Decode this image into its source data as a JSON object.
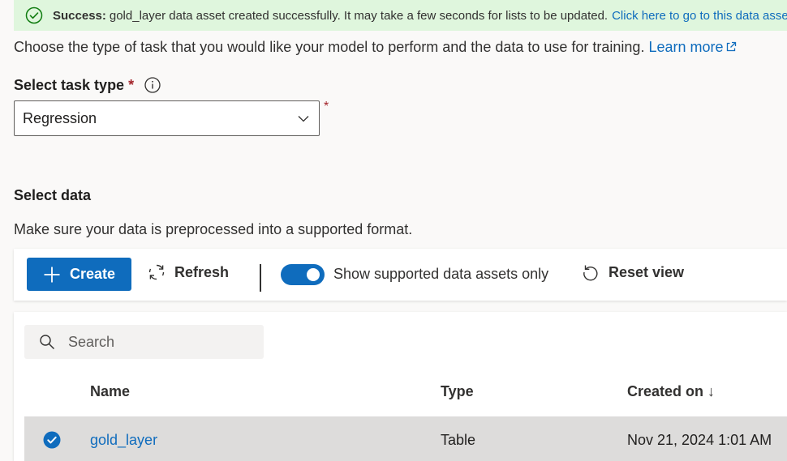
{
  "banner": {
    "lead": "Success:",
    "message": "gold_layer data asset created successfully. It may take a few seconds for lists to be updated.",
    "link": "Click here to go to this data asset"
  },
  "intro": {
    "text": "Choose the type of task that you would like your model to perform and the data to use for training.",
    "learn_more": "Learn more"
  },
  "task": {
    "label": "Select task type",
    "required_mark": "*",
    "selected": "Regression"
  },
  "data_section": {
    "title": "Select data",
    "description": "Make sure your data is preprocessed into a supported format."
  },
  "toolbar": {
    "create": "Create",
    "refresh": "Refresh",
    "toggle_label": "Show supported data assets only",
    "toggle_on": true,
    "reset": "Reset view"
  },
  "search": {
    "placeholder": "Search"
  },
  "table": {
    "columns": {
      "name": "Name",
      "type": "Type",
      "created": "Created on ↓"
    },
    "rows": [
      {
        "name": "gold_layer",
        "type": "Table",
        "created": "Nov 21, 2024 1:01 AM",
        "selected": true
      }
    ]
  },
  "colors": {
    "accent": "#0f6cbd",
    "success_bg": "#dff6dd",
    "success_icon": "#107c10",
    "required": "#a4262c"
  },
  "icons": [
    "success-check-icon",
    "external-link-icon",
    "info-icon",
    "chevron-down-icon",
    "plus-icon",
    "refresh-icon",
    "reset-icon",
    "search-icon",
    "checkmark-circle-icon"
  ]
}
